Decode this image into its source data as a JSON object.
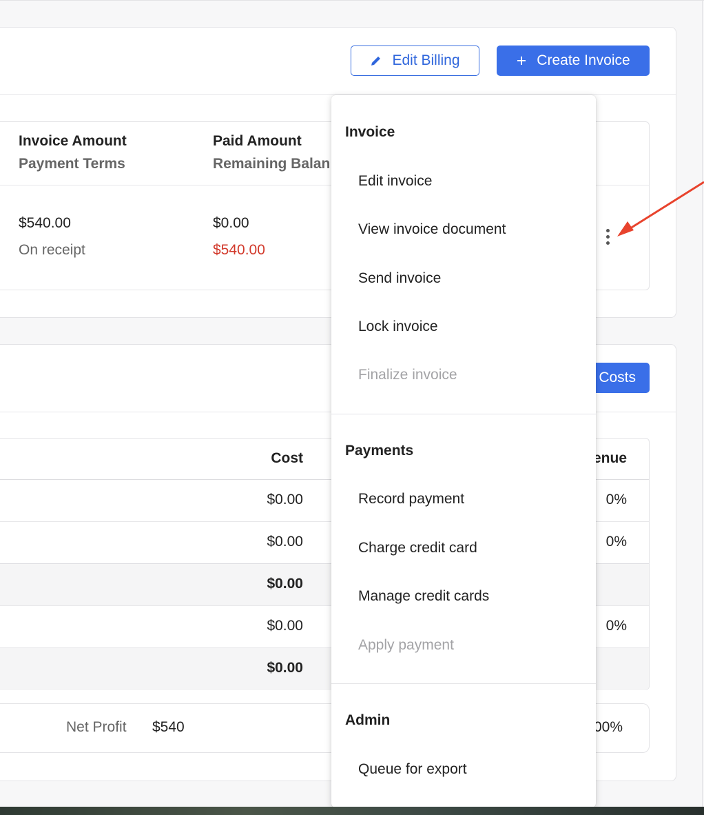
{
  "toolbar": {
    "edit_billing_label": "Edit Billing",
    "create_invoice_label": "Create Invoice"
  },
  "invoice_table": {
    "col1_header": "Invoice Amount",
    "col1_subheader": "Payment Terms",
    "col2_header": "Paid Amount",
    "col2_subheader": "Remaining Balan",
    "row": {
      "invoice_amount": "$540.00",
      "payment_terms": "On receipt",
      "paid_amount": "$0.00",
      "remaining_balance": "$540.00"
    }
  },
  "costs": {
    "add_costs_label": "Costs",
    "cost_header": "Cost",
    "revenue_header": "enue",
    "rows": [
      {
        "cost": "$0.00",
        "pct": "0%"
      },
      {
        "cost": "$0.00",
        "pct": "0%"
      },
      {
        "cost": "$0.00",
        "pct": ""
      },
      {
        "cost": "$0.00",
        "pct": "0%"
      },
      {
        "cost": "$0.00",
        "pct": ""
      }
    ],
    "net_profit_label": "Net Profit",
    "net_profit_value": "$540",
    "net_profit_pct": "00%"
  },
  "menu": {
    "invoice_section": "Invoice",
    "invoice_items": [
      {
        "label": "Edit invoice",
        "disabled": false
      },
      {
        "label": "View invoice document",
        "disabled": false
      },
      {
        "label": "Send invoice",
        "disabled": false
      },
      {
        "label": "Lock invoice",
        "disabled": false
      },
      {
        "label": "Finalize invoice",
        "disabled": true
      }
    ],
    "payments_section": "Payments",
    "payments_items": [
      {
        "label": "Record payment",
        "disabled": false
      },
      {
        "label": "Charge credit card",
        "disabled": false
      },
      {
        "label": "Manage credit cards",
        "disabled": false
      },
      {
        "label": "Apply payment",
        "disabled": true
      }
    ],
    "admin_section": "Admin",
    "admin_items": [
      {
        "label": "Queue for export",
        "disabled": false
      }
    ]
  },
  "colors": {
    "primary": "#3a6fe8",
    "danger": "#d23a2c",
    "annotation_arrow": "#e8432d"
  },
  "icons": [
    "pencil-icon",
    "plus-icon",
    "kebab-menu-icon",
    "annotation-arrow"
  ]
}
